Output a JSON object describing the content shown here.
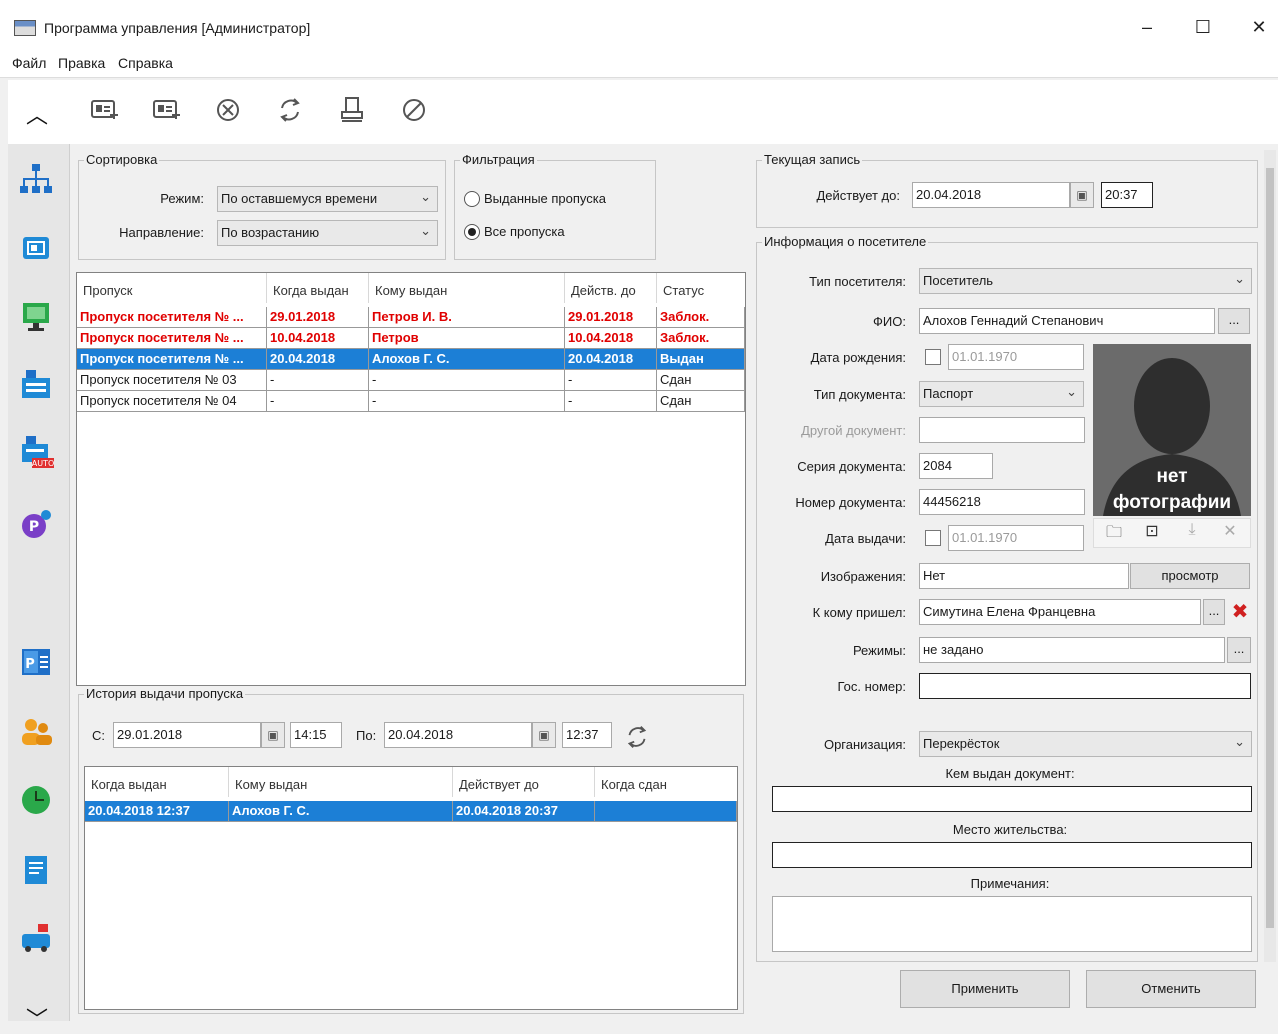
{
  "window": {
    "title": "Программа управления [Администратор]",
    "minimize": "–",
    "maximize": "☐",
    "close": "✕"
  },
  "menu": [
    "Файл",
    "Правка",
    "Справка"
  ],
  "sidebar": {
    "collapse_up": "︿",
    "collapse_down": "﹀"
  },
  "sorting": {
    "legend": "Сортировка",
    "mode_label": "Режим:",
    "mode_value": "По оставшемуся времени",
    "direction_label": "Направление:",
    "direction_value": "По возрастанию"
  },
  "filter": {
    "legend": "Фильтрация",
    "option1": "Выданные пропуска",
    "option2": "Все пропуска",
    "selected": "Все пропуска"
  },
  "passes": {
    "columns": [
      "Пропуск",
      "Когда выдан",
      "Кому выдан",
      "Действ. до",
      "Статус"
    ],
    "rows": [
      [
        "Пропуск посетителя № ...",
        "29.01.2018",
        "Петров И. В.",
        "29.01.2018",
        "Заблок."
      ],
      [
        "Пропуск посетителя № ...",
        "10.04.2018",
        "Петров",
        "10.04.2018",
        "Заблок."
      ],
      [
        "Пропуск посетителя № ...",
        "20.04.2018",
        "Алохов Г. С.",
        "20.04.2018",
        "Выдан"
      ],
      [
        "Пропуск посетителя № 03",
        "-",
        "-",
        "-",
        "Сдан"
      ],
      [
        "Пропуск посетителя № 04",
        "-",
        "-",
        "-",
        "Сдан"
      ]
    ]
  },
  "history": {
    "legend": "История выдачи пропуска",
    "from_label": "С:",
    "from_date": "29.01.2018",
    "from_time": "14:15",
    "to_label": "По:",
    "to_date": "20.04.2018",
    "to_time": "12:37",
    "columns": [
      "Когда выдан",
      "Кому выдан",
      "Действует до",
      "Когда сдан"
    ],
    "rows": [
      [
        "20.04.2018 12:37",
        "Алохов Г. С.",
        "20.04.2018 20:37",
        ""
      ]
    ]
  },
  "current": {
    "legend": "Текущая запись",
    "valid_label": "Действует до:",
    "valid_date": "20.04.2018",
    "valid_time": "20:37"
  },
  "visitor": {
    "legend": "Информация о посетителе",
    "type_label": "Тип посетителя:",
    "type_value": "Посетитель",
    "fio_label": "ФИО:",
    "fio_value": "Алохов Геннадий Степанович",
    "birth_label": "Дата рождения:",
    "birth_value": "01.01.1970",
    "doctype_label": "Тип документа:",
    "doctype_value": "Паспорт",
    "otherdoc_label": "Другой документ:",
    "series_label": "Серия документа:",
    "series_value": "2084",
    "number_label": "Номер документа:",
    "number_value": "44456218",
    "issue_label": "Дата выдачи:",
    "issue_value": "01.01.1970",
    "images_label": "Изображения:",
    "images_value": "Нет",
    "view_button": "просмотр",
    "whom_label": "К кому пришел:",
    "whom_value": "Симутина Елена Францевна",
    "modes_label": "Режимы:",
    "modes_value": "не задано",
    "plate_label": "Гос. номер:",
    "org_label": "Организация:",
    "org_value": "Перекрёсток",
    "issuedby_label": "Кем выдан документ:",
    "residence_label": "Место жительства:",
    "notes_label": "Примечания:",
    "photo_text1": "нет",
    "photo_text2": "фотографии",
    "ellipsis": "..."
  },
  "actions": {
    "apply": "Применить",
    "cancel": "Отменить"
  },
  "colors": {
    "selection": "#1c7fd6",
    "blocked": "#e00000"
  }
}
